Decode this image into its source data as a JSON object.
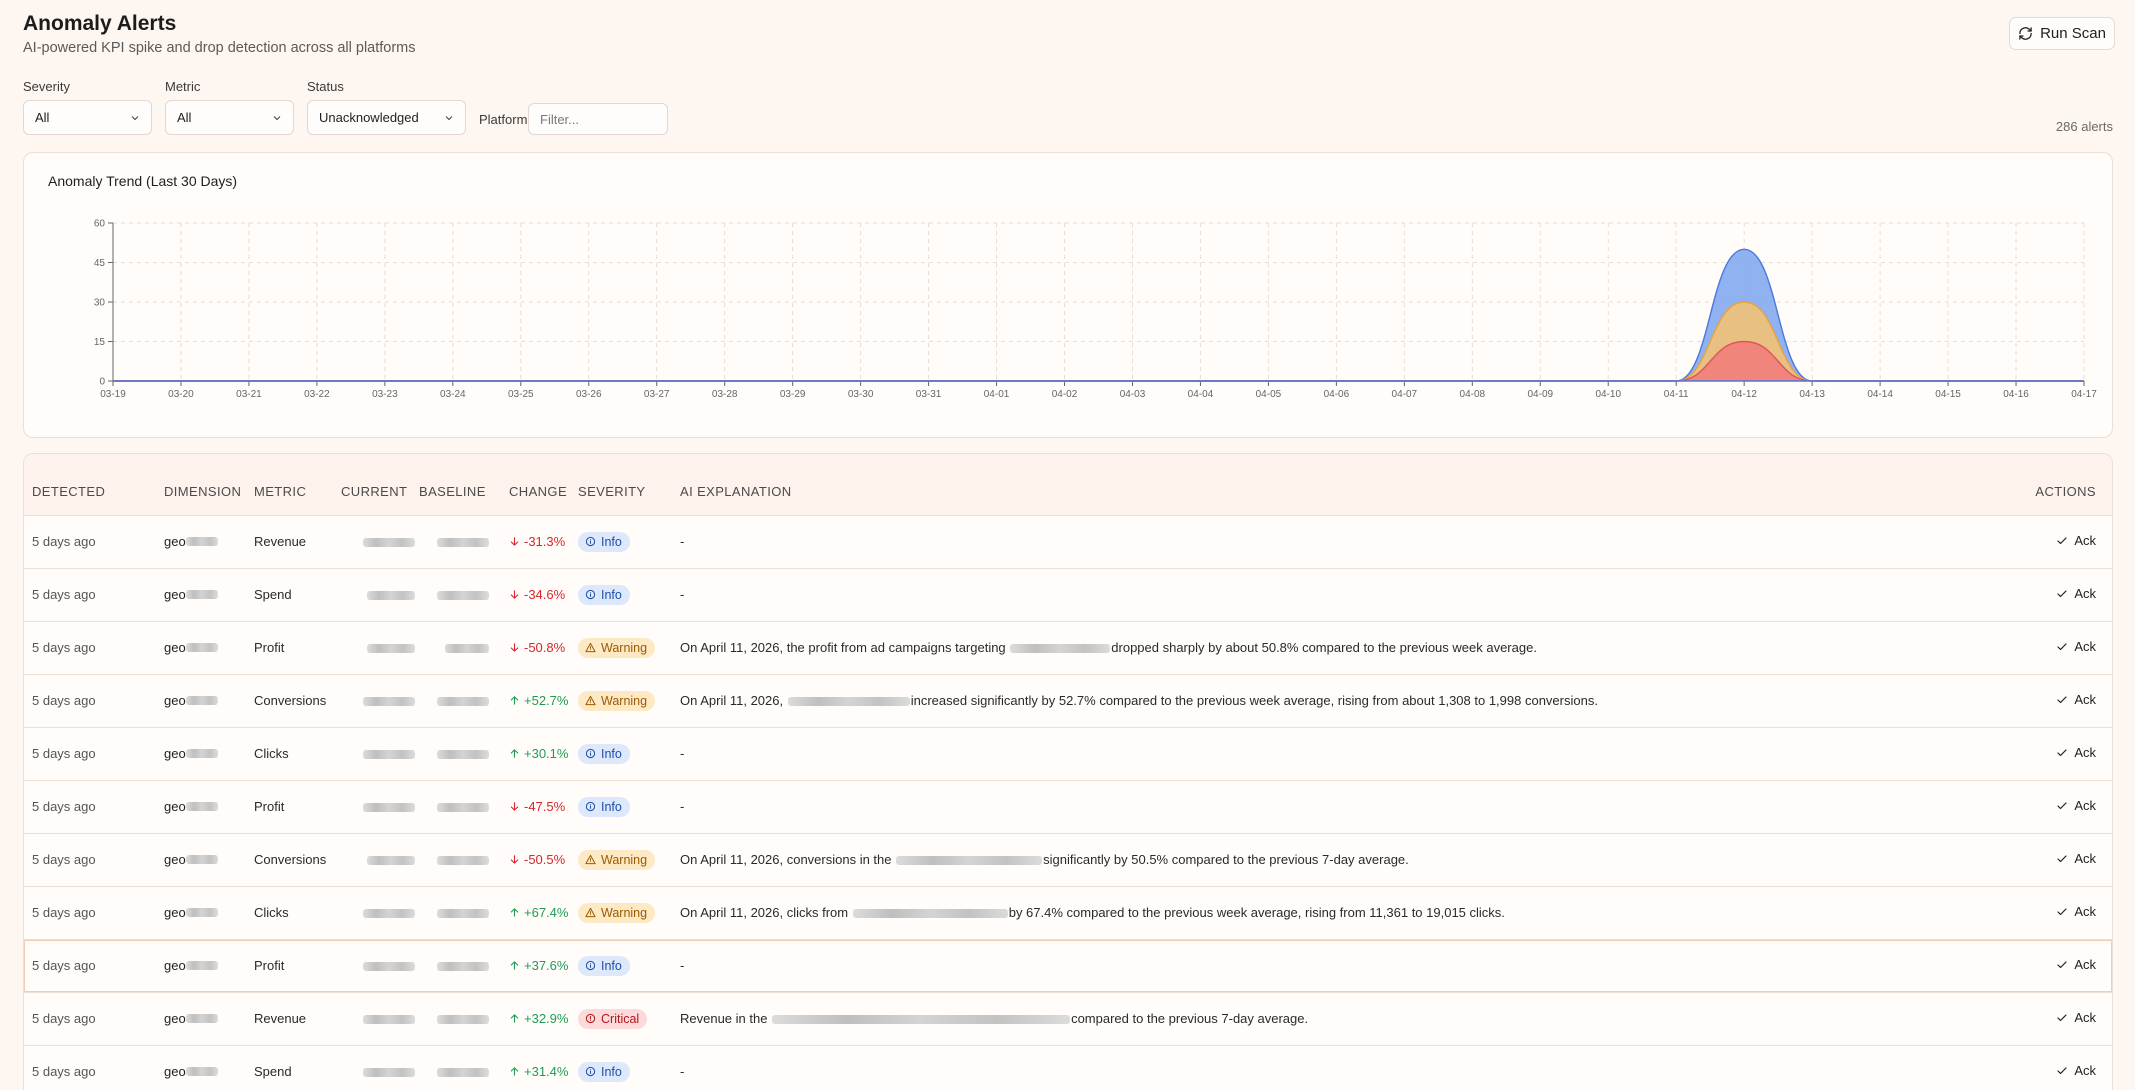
{
  "header": {
    "title": "Anomaly Alerts",
    "subtitle": "AI-powered KPI spike and drop detection across all platforms",
    "run_scan_label": "Run Scan"
  },
  "filters": {
    "severity": {
      "label": "Severity",
      "value": "All"
    },
    "metric": {
      "label": "Metric",
      "value": "All"
    },
    "status": {
      "label": "Status",
      "value": "Unacknowledged"
    },
    "platform": {
      "label": "Platform",
      "placeholder": "Filter..."
    },
    "alert_count": "286 alerts"
  },
  "chart_data": {
    "type": "area",
    "title": "Anomaly Trend (Last 30 Days)",
    "x": [
      "03-19",
      "03-20",
      "03-21",
      "03-22",
      "03-23",
      "03-24",
      "03-25",
      "03-26",
      "03-27",
      "03-28",
      "03-29",
      "03-30",
      "03-31",
      "04-01",
      "04-02",
      "04-03",
      "04-04",
      "04-05",
      "04-06",
      "04-07",
      "04-08",
      "04-09",
      "04-10",
      "04-11",
      "04-12",
      "04-13",
      "04-14",
      "04-15",
      "04-16",
      "04-17"
    ],
    "stacked": true,
    "series": [
      {
        "values": [
          0,
          0,
          0,
          0,
          0,
          0,
          0,
          0,
          0,
          0,
          0,
          0,
          0,
          0,
          0,
          0,
          0,
          0,
          0,
          0,
          0,
          0,
          0,
          0,
          15,
          0,
          0,
          0,
          0,
          0
        ],
        "color": "#f07a7a"
      },
      {
        "values": [
          0,
          0,
          0,
          0,
          0,
          0,
          0,
          0,
          0,
          0,
          0,
          0,
          0,
          0,
          0,
          0,
          0,
          0,
          0,
          0,
          0,
          0,
          0,
          0,
          15,
          0,
          0,
          0,
          0,
          0
        ],
        "color": "#f7c26d"
      },
      {
        "values": [
          0,
          0,
          0,
          0,
          0,
          0,
          0,
          0,
          0,
          0,
          0,
          0,
          0,
          0,
          0,
          0,
          0,
          0,
          0,
          0,
          0,
          0,
          0,
          0,
          20,
          0,
          0,
          0,
          0,
          0
        ],
        "color": "#7ea5f0"
      }
    ],
    "ylim": [
      0,
      60
    ],
    "yticks": [
      0,
      15,
      30,
      45,
      60
    ],
    "grid": true
  },
  "table": {
    "columns": {
      "detected": "DETECTED",
      "dimension": "DIMENSION",
      "metric": "METRIC",
      "current": "CURRENT",
      "baseline": "BASELINE",
      "change": "CHANGE",
      "severity": "SEVERITY",
      "explanation": "AI EXPLANATION",
      "actions": "ACTIONS"
    },
    "ack_label": "Ack",
    "rows": [
      {
        "detected": "5 days ago",
        "dimension": "geo",
        "metric": "Revenue",
        "change": "-31.3%",
        "direction": "down",
        "severity": "Info",
        "explanation_pre": "-",
        "explanation_post": ""
      },
      {
        "detected": "5 days ago",
        "dimension": "geo",
        "metric": "Spend",
        "change": "-34.6%",
        "direction": "down",
        "severity": "Info",
        "explanation_pre": "-",
        "explanation_post": ""
      },
      {
        "detected": "5 days ago",
        "dimension": "geo",
        "metric": "Profit",
        "change": "-50.8%",
        "direction": "down",
        "severity": "Warning",
        "explanation_pre": "On April 11, 2026, the profit from ad campaigns targeting ",
        "explanation_post": "dropped sharply by about 50.8% compared to the previous week average."
      },
      {
        "detected": "5 days ago",
        "dimension": "geo",
        "metric": "Conversions",
        "change": "+52.7%",
        "direction": "up",
        "severity": "Warning",
        "explanation_pre": "On April 11, 2026, ",
        "explanation_post": "increased significantly by 52.7% compared to the previous week average, rising from about 1,308 to 1,998 conversions."
      },
      {
        "detected": "5 days ago",
        "dimension": "geo",
        "metric": "Clicks",
        "change": "+30.1%",
        "direction": "up",
        "severity": "Info",
        "explanation_pre": "-",
        "explanation_post": ""
      },
      {
        "detected": "5 days ago",
        "dimension": "geo",
        "metric": "Profit",
        "change": "-47.5%",
        "direction": "down",
        "severity": "Info",
        "explanation_pre": "-",
        "explanation_post": ""
      },
      {
        "detected": "5 days ago",
        "dimension": "geo",
        "metric": "Conversions",
        "change": "-50.5%",
        "direction": "down",
        "severity": "Warning",
        "explanation_pre": "On April 11, 2026, conversions in the ",
        "explanation_post": "significantly by 50.5% compared to the previous 7-day average."
      },
      {
        "detected": "5 days ago",
        "dimension": "geo",
        "metric": "Clicks",
        "change": "+67.4%",
        "direction": "up",
        "severity": "Warning",
        "explanation_pre": "On April 11, 2026, clicks from ",
        "explanation_post": "by 67.4% compared to the previous week average, rising from 11,361 to 19,015 clicks."
      },
      {
        "detected": "5 days ago",
        "dimension": "geo",
        "metric": "Profit",
        "change": "+37.6%",
        "direction": "up",
        "severity": "Info",
        "explanation_pre": "-",
        "explanation_post": ""
      },
      {
        "detected": "5 days ago",
        "dimension": "geo",
        "metric": "Revenue",
        "change": "+32.9%",
        "direction": "up",
        "severity": "Critical",
        "explanation_pre": "Revenue in the ",
        "explanation_post": "compared to the previous 7-day average."
      },
      {
        "detected": "5 days ago",
        "dimension": "geo",
        "metric": "Spend",
        "change": "+31.4%",
        "direction": "up",
        "severity": "Info",
        "explanation_pre": "-",
        "explanation_post": ""
      }
    ]
  }
}
